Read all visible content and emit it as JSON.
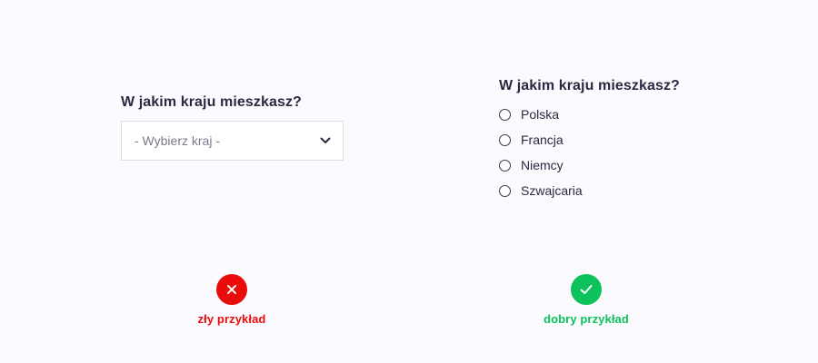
{
  "bad_example": {
    "question": "W jakim kraju mieszkasz?",
    "select_placeholder": "- Wybierz kraj -",
    "chevron_icon": "chevron-down-icon",
    "verdict_icon": "close-icon",
    "verdict_label": "zły przykład",
    "verdict_color": "#ea0b0b"
  },
  "good_example": {
    "question": "W jakim kraju mieszkasz?",
    "options": [
      {
        "label": "Polska"
      },
      {
        "label": "Francja"
      },
      {
        "label": "Niemcy"
      },
      {
        "label": "Szwajcaria"
      }
    ],
    "verdict_icon": "check-icon",
    "verdict_label": "dobry przykład",
    "verdict_color": "#0cc25a"
  }
}
